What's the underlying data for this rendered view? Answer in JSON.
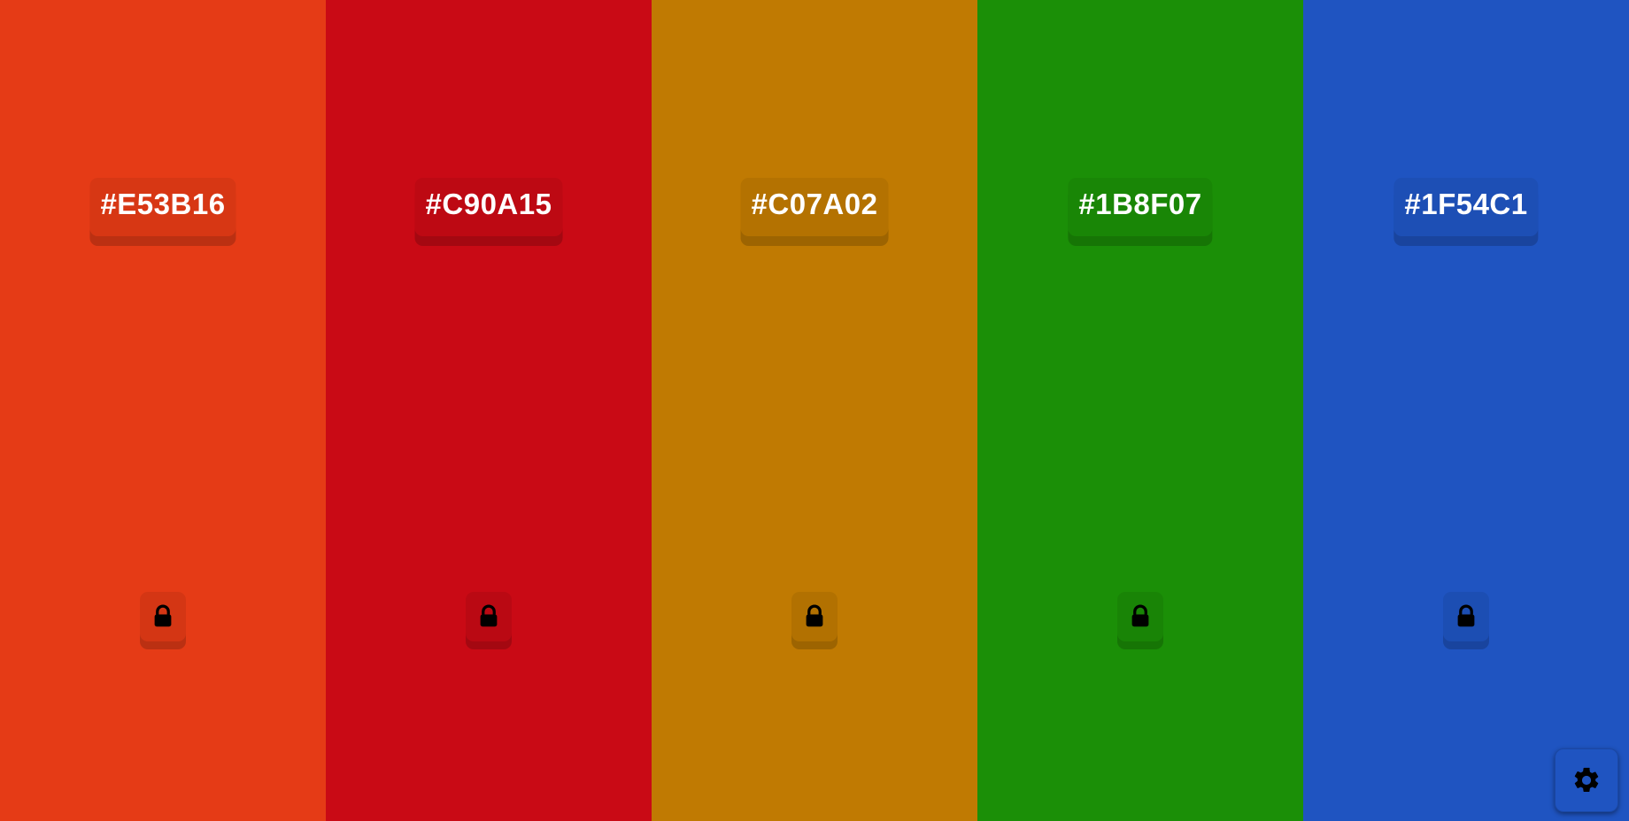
{
  "palette": {
    "colors": [
      {
        "hex": "#E53B16",
        "locked_icon": "lock-icon"
      },
      {
        "hex": "#C90A15",
        "locked_icon": "lock-icon"
      },
      {
        "hex": "#C07A02",
        "locked_icon": "lock-icon"
      },
      {
        "hex": "#1B8F07",
        "locked_icon": "lock-icon"
      },
      {
        "hex": "#1F54C1",
        "locked_icon": "lock-icon"
      }
    ]
  },
  "settings": {
    "icon": "gear-icon",
    "background": "#1F54C1"
  }
}
